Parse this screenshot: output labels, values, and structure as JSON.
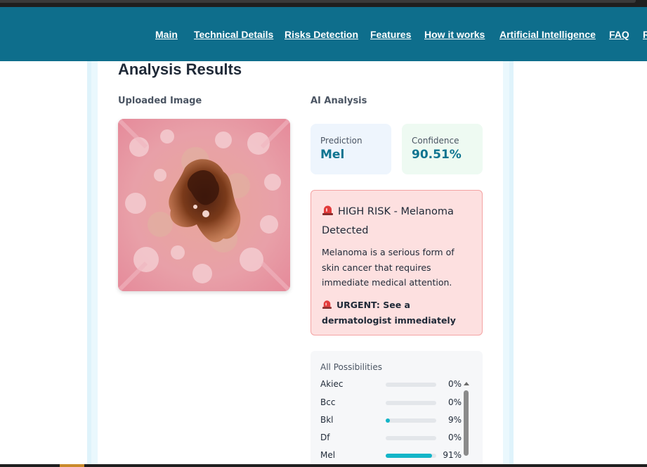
{
  "nav": {
    "links": [
      "Main",
      "Technical Details",
      "Risks Detection",
      "Features",
      "How it works",
      "Artificial Intelligence",
      "FAQ",
      "R"
    ]
  },
  "results": {
    "title": "Analysis Results",
    "uploaded_label": "Uploaded Image",
    "ai_label": "AI Analysis"
  },
  "prediction": {
    "label": "Prediction",
    "value": "Mel"
  },
  "confidence": {
    "label": "Confidence",
    "value": "90.51%"
  },
  "risk": {
    "title": "HIGH RISK - Melanoma Detected",
    "description": "Melanoma is a serious form of skin cancer that requires immediate medical attention.",
    "urgent": "URGENT: See a dermatologist immediately",
    "icon": "siren-icon"
  },
  "possibilities": {
    "title": "All Possibilities",
    "items": [
      {
        "name": "Akiec",
        "pct": "0%",
        "value": 0
      },
      {
        "name": "Bcc",
        "pct": "0%",
        "value": 0
      },
      {
        "name": "Bkl",
        "pct": "9%",
        "value": 9
      },
      {
        "name": "Df",
        "pct": "0%",
        "value": 0
      },
      {
        "name": "Mel",
        "pct": "91%",
        "value": 91
      }
    ]
  },
  "colors": {
    "nav_bg": "#0e6e8c",
    "accent": "#0e7490",
    "bar_fill": "#13b5c8",
    "risk_bg": "#fde0e0",
    "risk_border": "#f4a3a3"
  }
}
